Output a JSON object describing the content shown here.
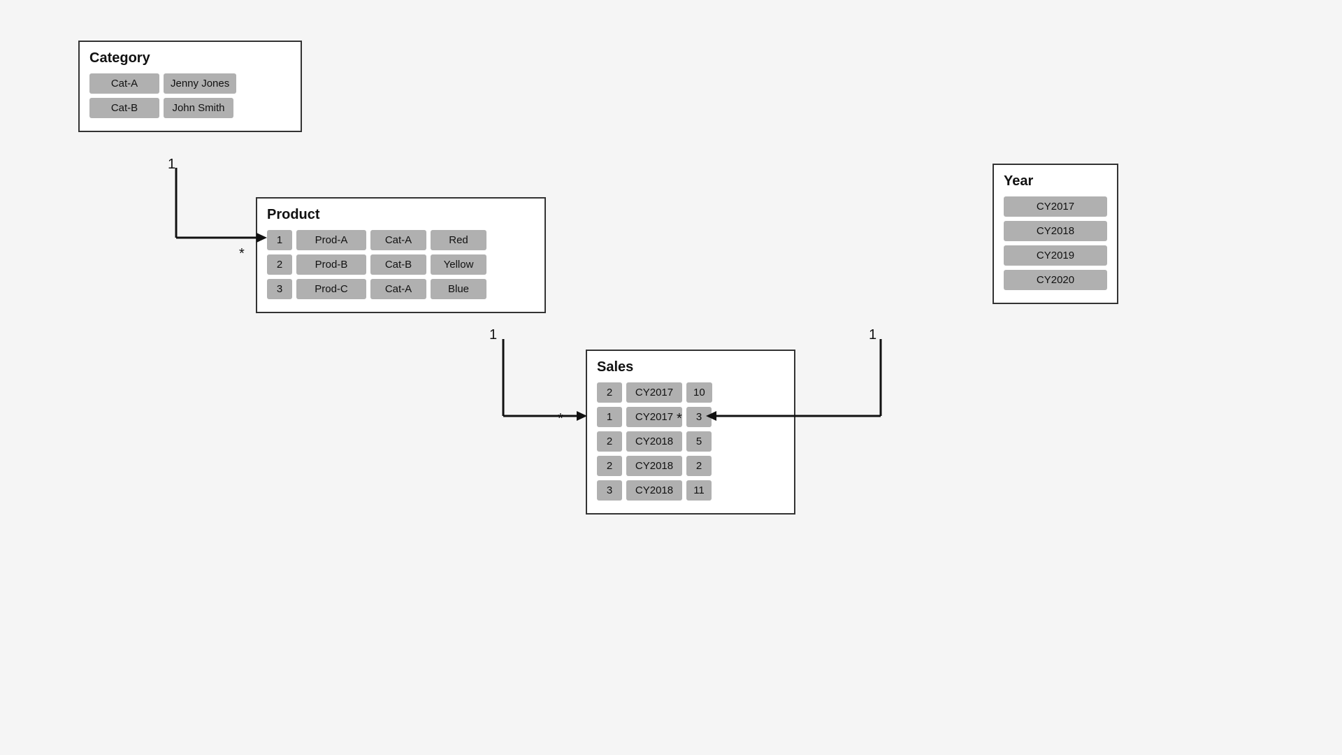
{
  "category_table": {
    "title": "Category",
    "rows": [
      [
        "Cat-A",
        "Jenny Jones"
      ],
      [
        "Cat-B",
        "John Smith"
      ]
    ]
  },
  "product_table": {
    "title": "Product",
    "rows": [
      [
        "1",
        "Prod-A",
        "Cat-A",
        "Red"
      ],
      [
        "2",
        "Prod-B",
        "Cat-B",
        "Yellow"
      ],
      [
        "3",
        "Prod-C",
        "Cat-A",
        "Blue"
      ]
    ]
  },
  "year_table": {
    "title": "Year",
    "rows": [
      [
        "CY2017"
      ],
      [
        "CY2018"
      ],
      [
        "CY2019"
      ],
      [
        "CY2020"
      ]
    ]
  },
  "sales_table": {
    "title": "Sales",
    "rows": [
      [
        "2",
        "CY2017",
        "10"
      ],
      [
        "1",
        "CY2017",
        "3"
      ],
      [
        "2",
        "CY2018",
        "5"
      ],
      [
        "2",
        "CY2018",
        "2"
      ],
      [
        "3",
        "CY2018",
        "11"
      ]
    ]
  },
  "relations": {
    "cat_to_product": {
      "from": "1",
      "to": "*"
    },
    "product_to_sales": {
      "from": "1",
      "to": "*"
    },
    "year_to_sales": {
      "from": "1",
      "to": "*"
    }
  }
}
